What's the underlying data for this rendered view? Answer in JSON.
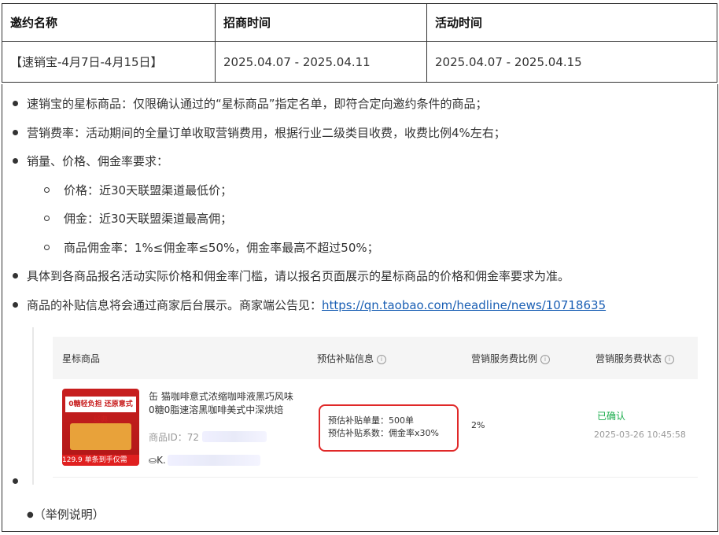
{
  "table": {
    "headers": [
      "邀约名称",
      "招商时间",
      "活动时间"
    ],
    "row": [
      "【速销宝-4月7日-4月15日】",
      "2025.04.07 - 2025.04.11",
      "2025.04.07 - 2025.04.15"
    ]
  },
  "bullets": {
    "b1": "速销宝的星标商品：仅限确认通过的“星标商品”指定名单，即符合定向邀约条件的商品；",
    "b2": "营销费率：活动期间的全量订单收取营销费用，根据行业二级类目收费，收费比例4%左右；",
    "b3": "销量、价格、佣金率要求：",
    "s1": "价格：近30天联盟渠道最低价；",
    "s2": "佣金：近30天联盟渠道最高佣；",
    "s3": "商品佣金率：1%≤佣金率≤50%，佣金率最高不超过50%；",
    "b4": "具体到各商品报名活动实际价格和佣金率门槛，请以报名页面展示的星标商品的价格和佣金率要求为准。",
    "b5_text": "商品的补贴信息将会通过商家后台展示。商家端公告见：",
    "b5_link": "https://qn.taobao.com/headline/news/10718635",
    "example": "（举例说明）"
  },
  "screenshot": {
    "headers": {
      "product": "星标商品",
      "subsidy": "预估补贴信息",
      "rate": "营销服务费比例",
      "status": "营销服务费状态"
    },
    "product": {
      "title": "缶 猫咖啡意式浓缩咖啡液黑巧风味0糖0脂速溶黑咖啡美式中深烘焙",
      "id_label": "商品ID：72",
      "shop": "K.",
      "thumb_tag": "0糖轻负担 还原意式经典",
      "thumb_price": "129.9 单条到手仅需¥1.62"
    },
    "subsidy_line1": "预估补贴单量：500单",
    "subsidy_line2": "预估补贴系数：佣金率x30%",
    "rate_value": "2%",
    "status_value": "已确认",
    "status_time": "2025-03-26 10:45:58"
  },
  "colors": {
    "link": "#1a5fb4",
    "confirmed": "#1aad4c",
    "highlight": "#e02828"
  }
}
